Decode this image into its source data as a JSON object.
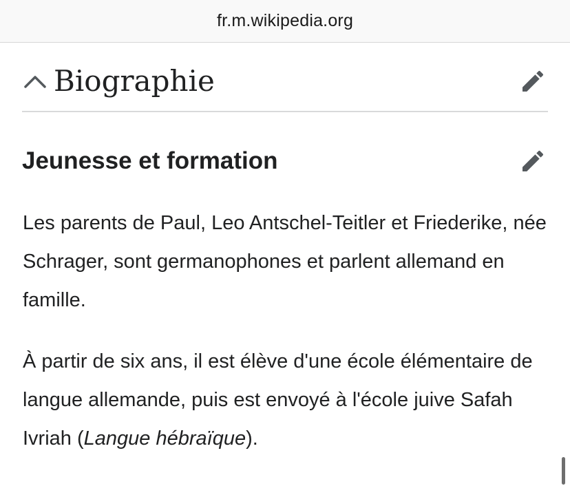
{
  "browser": {
    "url": "fr.m.wikipedia.org"
  },
  "section": {
    "title": "Biographie",
    "collapse_icon": "chevron-up-icon",
    "edit_icon": "pencil-icon"
  },
  "subsection": {
    "title": "Jeunesse et formation",
    "edit_icon": "pencil-icon"
  },
  "paragraphs": {
    "p1": "Les parents de Paul, Leo Antschel-Teitler et Friederike, née Schrager, sont germanophones et parlent allemand en famille.",
    "p2_before": "À partir de six ans, il est élève d'une école élémentaire de langue allemande, puis est envoyé à l'école juive Safah Ivriah (",
    "p2_italic": "Langue hébraïque",
    "p2_after": ")."
  },
  "colors": {
    "text": "#202122",
    "icon": "#54595d",
    "divider": "#d8d9da",
    "urlbar_bg": "#f9f9f9"
  }
}
